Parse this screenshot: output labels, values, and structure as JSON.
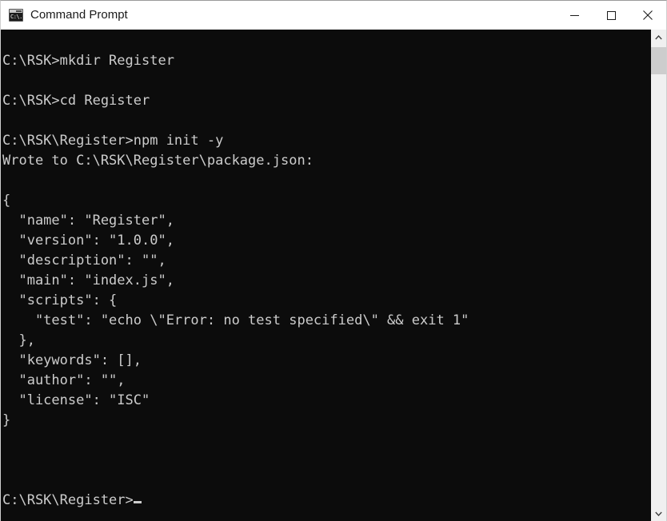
{
  "window": {
    "title": "Command Prompt",
    "icon": "command-prompt-icon",
    "icon_glyph": "C:\\.",
    "controls": {
      "minimize": "minimize-icon",
      "maximize": "maximize-icon",
      "close": "close-icon"
    }
  },
  "theme": {
    "titlebar_background": "#ffffff",
    "titlebar_text": "#1a1a1a",
    "console_background": "#0c0c0c",
    "console_text": "#cccccc",
    "scrollbar_track": "#f0f0f0",
    "scrollbar_thumb": "#cdcdcd",
    "close_hover": "#e81123"
  },
  "console": {
    "lines": [
      "C:\\RSK>mkdir Register",
      "",
      "C:\\RSK>cd Register",
      "",
      "C:\\RSK\\Register>npm init -y",
      "Wrote to C:\\RSK\\Register\\package.json:",
      "",
      "{",
      "  \"name\": \"Register\",",
      "  \"version\": \"1.0.0\",",
      "  \"description\": \"\",",
      "  \"main\": \"index.js\",",
      "  \"scripts\": {",
      "    \"test\": \"echo \\\"Error: no test specified\\\" && exit 1\"",
      "  },",
      "  \"keywords\": [],",
      "  \"author\": \"\",",
      "  \"license\": \"ISC\"",
      "}",
      "",
      "",
      "",
      "C:\\RSK\\Register>"
    ],
    "prompt": "C:\\RSK\\Register>",
    "cursor": "block-cursor"
  },
  "scrollbar": {
    "up_arrow": "chevron-up-icon",
    "down_arrow": "chevron-down-icon",
    "thumb": "scrollbar-thumb"
  }
}
